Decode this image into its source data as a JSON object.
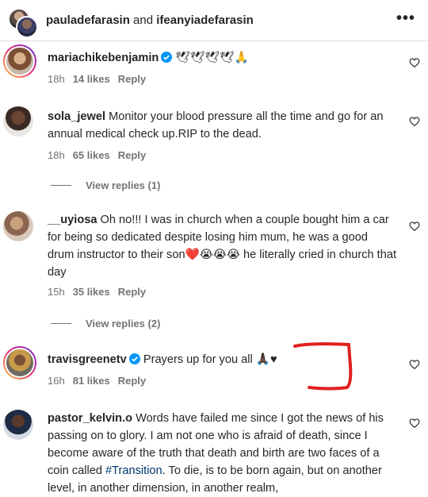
{
  "header": {
    "user1": "pauladefarasin",
    "connector": " and ",
    "user2": "ifeanyiadefarasin",
    "more_icon": "more-horizontal-icon",
    "more_glyph": "•••"
  },
  "comments": [
    {
      "username": "mariachikebenjamin",
      "verified": true,
      "text": "🕊🕊🕊🕊🙏",
      "time": "18h",
      "likes": "14 likes",
      "reply": "Reply"
    },
    {
      "username": "sola_jewel",
      "verified": false,
      "text": "Monitor your blood pressure all the time and go for an annual medical check up.RIP to the dead.",
      "time": "18h",
      "likes": "65 likes",
      "reply": "Reply",
      "view_replies": "View replies (1)"
    },
    {
      "username": "__uyiosa",
      "verified": false,
      "text": "Oh no!!! I was in church when a couple bought him a car for being so dedicated despite losing him mum, he was a good drum instructor to their son❤️😭😭😭 he literally cried in church that day",
      "time": "15h",
      "likes": "35 likes",
      "reply": "Reply",
      "view_replies": "View replies (2)"
    },
    {
      "username": "travisgreenetv",
      "verified": true,
      "text": "Prayers up for you all 🙏🏿♥",
      "time": "16h",
      "likes": "81 likes",
      "reply": "Reply"
    },
    {
      "username": "pastor_kelvin.o",
      "verified": false,
      "text_before": "Words have failed me since I got the news of his passing on to glory. I am not one who is afraid of death, since I become aware of the truth that death and birth are two faces of a coin called ",
      "hashtag": "#Transition",
      "text_after": ". To die, is to be born again, but on another level, in another dimension, in another realm,"
    }
  ],
  "colors": {
    "text": "#262626",
    "secondary": "#737373",
    "verified_blue": "#0095f6",
    "hashtag": "#00376b",
    "annotation_red": "#e02020"
  }
}
